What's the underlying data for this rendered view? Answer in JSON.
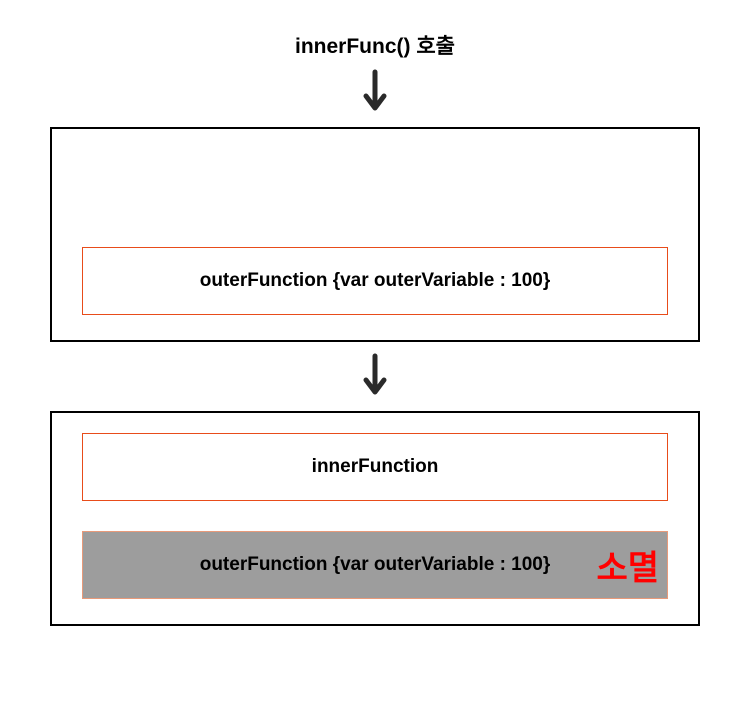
{
  "title": "innerFunc() 호출",
  "box1": {
    "outerFunction": "outerFunction {var outerVariable : 100}"
  },
  "box2": {
    "innerFunction": "innerFunction",
    "outerFunction": "outerFunction {var outerVariable : 100}",
    "destroyLabel": "소멸"
  }
}
